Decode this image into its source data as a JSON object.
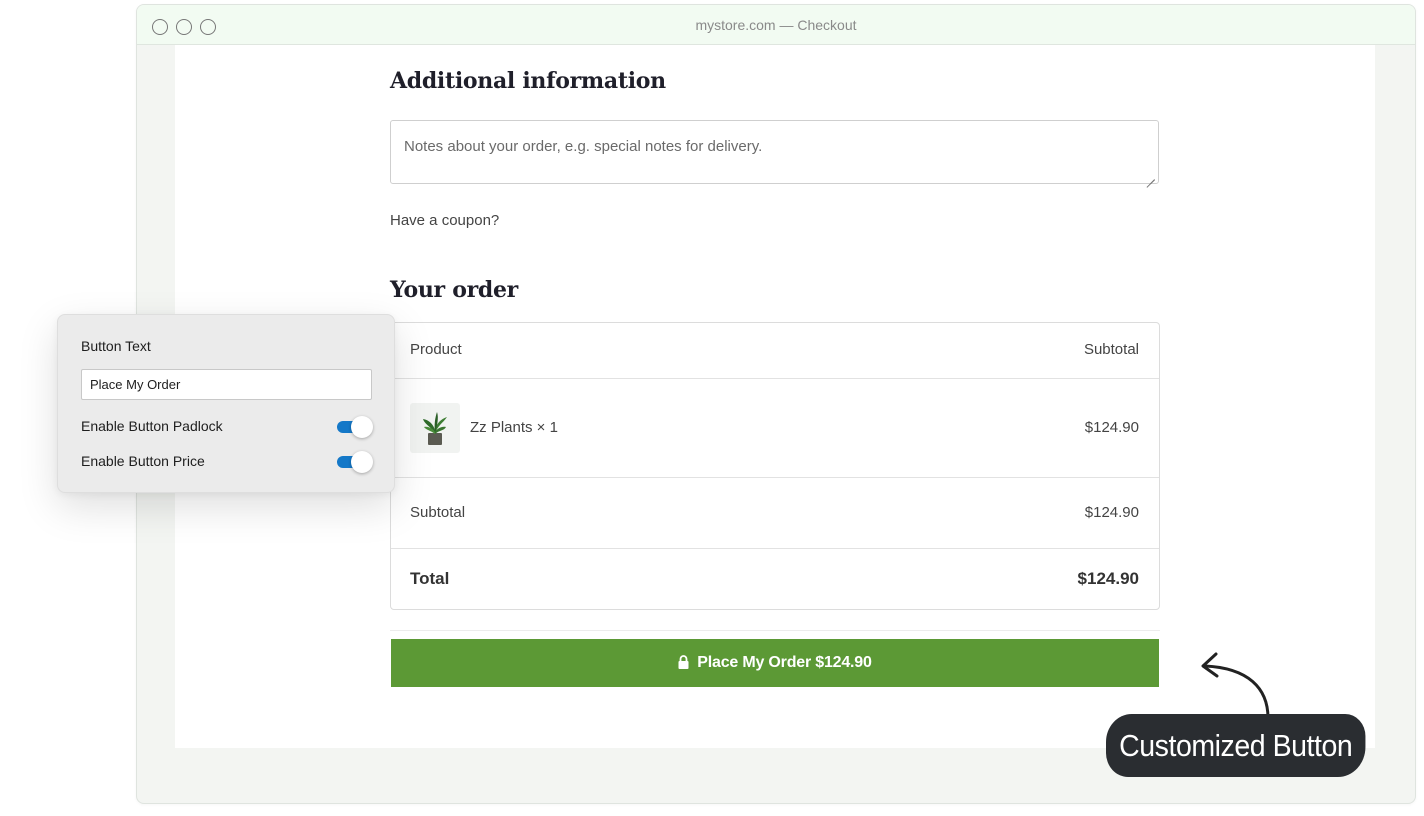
{
  "browser": {
    "title": "mystore.com — Checkout"
  },
  "checkout": {
    "additional_info_heading": "Additional information",
    "notes_placeholder": "Notes about your order, e.g. special notes for delivery.",
    "coupon_text": "Have a coupon?",
    "your_order_heading": "Your order",
    "table": {
      "col_product": "Product",
      "col_subtotal": "Subtotal",
      "item_name": "Zz Plants × 1",
      "item_price": "$124.90",
      "subtotal_label": "Subtotal",
      "subtotal_value": "$124.90",
      "total_label": "Total",
      "total_value": "$124.90"
    },
    "place_order_button": "Place My Order $124.90",
    "button_color": "#5c9935"
  },
  "settings_panel": {
    "button_text_label": "Button Text",
    "button_text_value": "Place My Order",
    "padlock_label": "Enable Button Padlock",
    "padlock_enabled": true,
    "price_label": "Enable Button Price",
    "price_enabled": true,
    "toggle_color": "#1478c8"
  },
  "annotation": {
    "label": "Customized Button"
  }
}
